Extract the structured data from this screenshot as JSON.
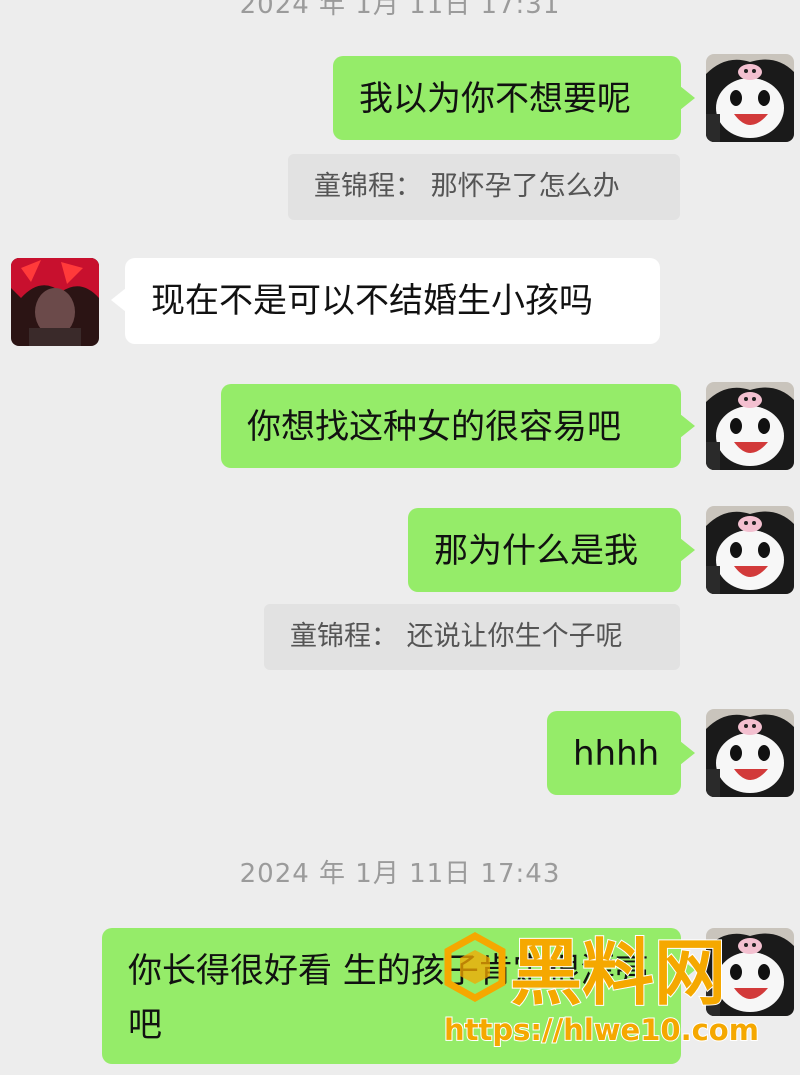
{
  "timestamps": [
    "2024 年 1月 11日 17:31",
    "2024 年 1月 11日 17:43"
  ],
  "messages": [
    {
      "side": "me",
      "text": "我以为你不想要呢"
    },
    {
      "side": "quote",
      "text": "童锦程：  那怀孕了怎么办"
    },
    {
      "side": "other",
      "text": "现在不是可以不结婚生小孩吗"
    },
    {
      "side": "me",
      "text": "你想找这种女的很容易吧"
    },
    {
      "side": "me",
      "text": "那为什么是我"
    },
    {
      "side": "quote",
      "text": "童锦程：  还说让你生个子呢"
    },
    {
      "side": "me",
      "text": "hhhh"
    },
    {
      "side": "me",
      "text": "你长得很好看 生的孩子肯定很漂亮吧"
    }
  ],
  "watermark": {
    "name": "黑料网",
    "url": "https://hlwe10.com"
  },
  "colors": {
    "background": "#ededed",
    "my_bubble": "#95ec69",
    "other_bubble": "#ffffff",
    "quote": "#e2e2e2",
    "watermark": "#f5a800"
  },
  "avatars": {
    "me": "kuromi-avatar",
    "other": "red-hair-anime-avatar"
  }
}
